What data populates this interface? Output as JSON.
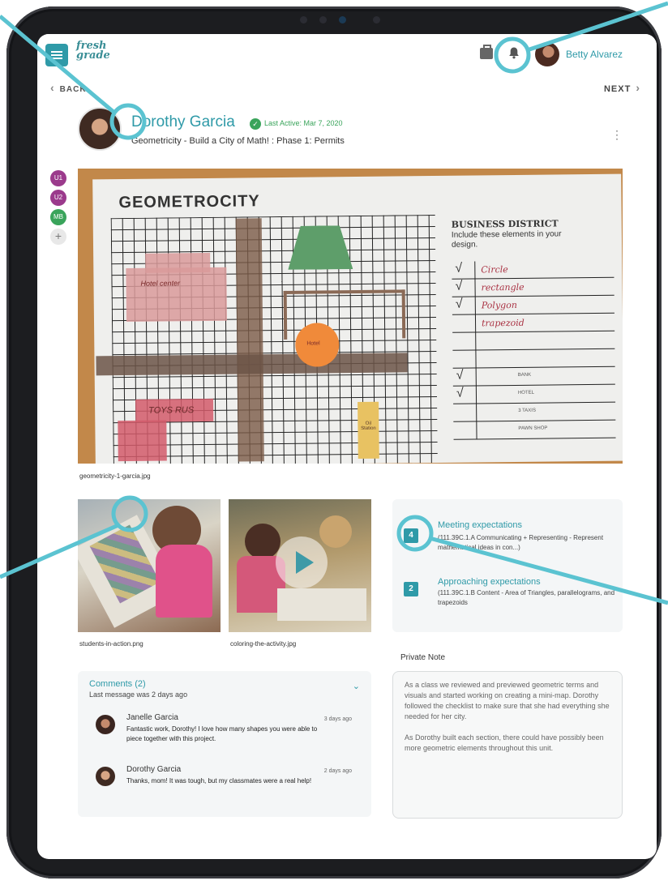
{
  "app": {
    "logo_line1": "fresh",
    "logo_line2": "grade"
  },
  "header": {
    "user_name": "Betty Alvarez"
  },
  "nav": {
    "back_label": "BACK",
    "next_label": "NEXT"
  },
  "student": {
    "name": "Dorothy Garcia",
    "last_active": "Last Active: Mar 7, 2020",
    "activity": "Geometricity - Build a City of Math! : Phase 1: Permits"
  },
  "badges": [
    "U1",
    "U2",
    "MB",
    "+"
  ],
  "badge_colors": [
    "#9b3a8c",
    "#9b3a8c",
    "#3aa45b",
    "#e8e8e8"
  ],
  "worksheet": {
    "title": "GEOMETROCITY",
    "business_title": "BUSINESS DISTRICT",
    "business_text": "Include these elements in your design.",
    "labels": [
      "Hotel center",
      "Hotel",
      "TOYS RUS",
      "Oil Station"
    ],
    "checklist": [
      {
        "tick": "√",
        "word": "Circle",
        "small": ""
      },
      {
        "tick": "√",
        "word": "rectangle",
        "small": ""
      },
      {
        "tick": "√",
        "word": "Polygon",
        "small": ""
      },
      {
        "tick": "",
        "word": "trapezoid",
        "small": ""
      },
      {
        "tick": "",
        "word": "",
        "small": ""
      },
      {
        "tick": "",
        "word": "",
        "small": ""
      },
      {
        "tick": "√",
        "word": "",
        "small": "BANK"
      },
      {
        "tick": "√",
        "word": "",
        "small": "HOTEL"
      },
      {
        "tick": "",
        "word": "",
        "small": "3 TAXIS"
      },
      {
        "tick": "",
        "word": "",
        "small": "PAWN SHOP"
      }
    ]
  },
  "media": {
    "main_caption": "geometricity-1-garcia.jpg",
    "thumb1_caption": "students-in-action.png",
    "thumb2_caption": "coloring-the-activity.jpg"
  },
  "standards": [
    {
      "level": "4",
      "title": "Meeting expectations",
      "desc": "(111.39C.1.A Communicating + Representing - Represent mathematical ideas in con...)"
    },
    {
      "level": "2",
      "title": "Approaching expectations",
      "desc": "(111.39C.1.B Content - Area of Triangles, parallelograms, and trapezoids"
    }
  ],
  "comments": {
    "title": "Comments (2)",
    "subtitle": "Last message was 2 days ago",
    "items": [
      {
        "name": "Janelle Garcia",
        "time": "3 days ago",
        "text": "Fantastic work, Dorothy! I love how many shapes you were able to piece together with this project."
      },
      {
        "name": "Dorothy Garcia",
        "time": "2 days ago",
        "text": "Thanks, mom! It was tough, but my classmates were a real help!"
      }
    ]
  },
  "private_note": {
    "label": "Private Note",
    "paragraph1": "As a class we reviewed and previewed geometric terms and visuals and started working on creating a mini-map. Dorothy followed the checklist to make sure that she had everything she needed for her city.",
    "paragraph2": "As Dorothy built each section, there could have possibly been more geometric elements throughout this unit."
  },
  "colors": {
    "accent": "#2f9aa8",
    "callout": "#5bc3d1",
    "success": "#3aa45b"
  }
}
